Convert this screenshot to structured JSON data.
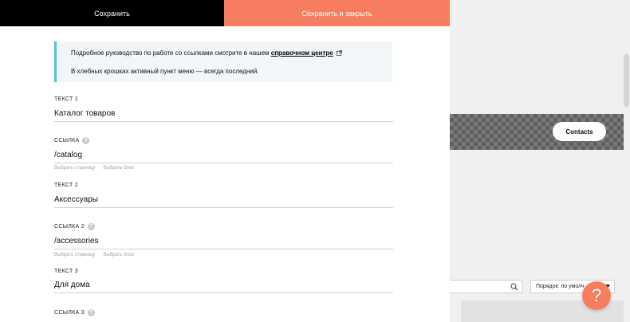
{
  "toolbar": {
    "save_label": "Сохранить",
    "save_close_label": "Сохранить и закрыть"
  },
  "note": {
    "line1_text": "Подробное руководство по работе со ссылками смотрите в нашем ",
    "line1_link": "справочном центре",
    "line2_text": "В хлебных крошках активный пункт меню — всегда последний."
  },
  "fields": {
    "text1": {
      "label": "ТЕКСТ 1",
      "value": "Каталог товаров"
    },
    "link1": {
      "label": "ССЫЛКА",
      "value": "/catalog",
      "select_page": "Выбрать страницу",
      "select_block": "Выбрать блок"
    },
    "text2": {
      "label": "ТЕКСТ 2",
      "value": "Аксессуары"
    },
    "link2": {
      "label": "ССЫЛКА 2",
      "value": "/accessories",
      "select_page": "Выбрать страницу",
      "select_block": "Выбрать блок"
    },
    "text3": {
      "label": "ТЕКСТ 3",
      "value": "Для дома"
    },
    "link3": {
      "label": "ССЫЛКА 3"
    }
  },
  "background": {
    "contacts_label": "Contacts",
    "sort_label": "Порядок: по умолч",
    "help_label": "?"
  },
  "colors": {
    "accent": "#f67d5f",
    "note_border": "#4fc1d8",
    "note_bg": "#f2f6f8"
  },
  "icons": [
    "external-link-icon",
    "question-icon",
    "search-icon",
    "dropdown-arrow-icon",
    "help-icon"
  ]
}
